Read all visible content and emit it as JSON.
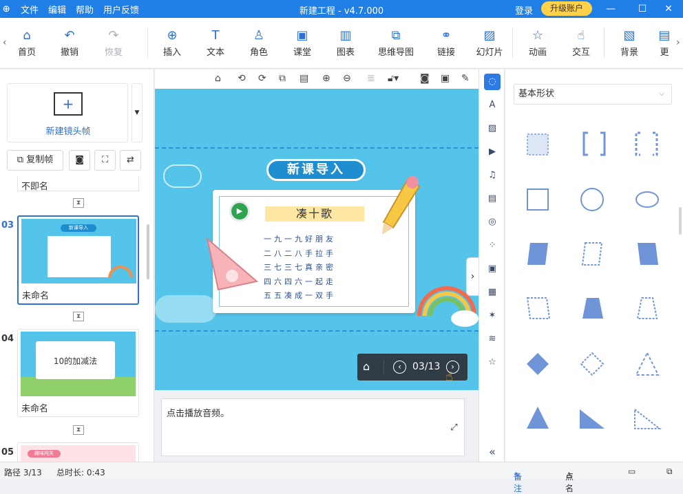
{
  "titlebar": {
    "logo_glyph": "᪠",
    "menus": [
      "文件",
      "编辑",
      "帮助",
      "用户反馈"
    ],
    "title": "新建工程 - v4.7.000",
    "login": "登录",
    "upgrade": "升级账户",
    "min": "—",
    "max": "☐",
    "close": "✕"
  },
  "toolbar": {
    "items": [
      {
        "label": "首页",
        "icon": "⌂"
      },
      {
        "label": "撤销",
        "icon": "↶"
      },
      {
        "label": "恢复",
        "icon": "↷",
        "disabled": true
      },
      {
        "label": "插入",
        "icon": "⊕"
      },
      {
        "label": "文本",
        "icon": "T"
      },
      {
        "label": "角色",
        "icon": "♙"
      },
      {
        "label": "课堂",
        "icon": "▣"
      },
      {
        "label": "图表",
        "icon": "▥"
      },
      {
        "label": "思维导图",
        "icon": "⧉"
      },
      {
        "label": "链接",
        "icon": "⚭"
      },
      {
        "label": "幻灯片",
        "icon": "▨"
      },
      {
        "label": "动画",
        "icon": "☆"
      },
      {
        "label": "交互",
        "icon": "☝"
      },
      {
        "label": "背景",
        "icon": "▧"
      },
      {
        "label": "更",
        "icon": "▤"
      }
    ],
    "left_arrow": "‹",
    "right_arrow": "›"
  },
  "left": {
    "new_frame": "新建镜头帧",
    "copy_frame": "复制帧",
    "partial_name": "不即名",
    "slides": [
      {
        "num": "03",
        "name": "未命名",
        "title": "新课导入"
      },
      {
        "num": "04",
        "name": "未命名",
        "title": "10的加减法"
      },
      {
        "num": "05",
        "name": "",
        "title": "趣味闯关"
      }
    ],
    "collapse": "‹"
  },
  "canvas": {
    "badge": "新课导入",
    "poem_title": "凑十歌",
    "lines": [
      "一九一九好朋友",
      "二八二八手拉手",
      "三七三七真亲密",
      "四六四六一起走",
      "五五凑成一双手"
    ],
    "page": "03/13",
    "play": "▶",
    "expand_right": "›"
  },
  "notes": {
    "text": "点击播放音频。",
    "expand": "⤢"
  },
  "shapes": {
    "category": "基本形状",
    "dropdown": "⌵",
    "collapse": "«"
  },
  "status": {
    "path": "路径 3/13",
    "duration": "总时长: 0:43",
    "remark": "备注",
    "rollcall": "点名"
  }
}
